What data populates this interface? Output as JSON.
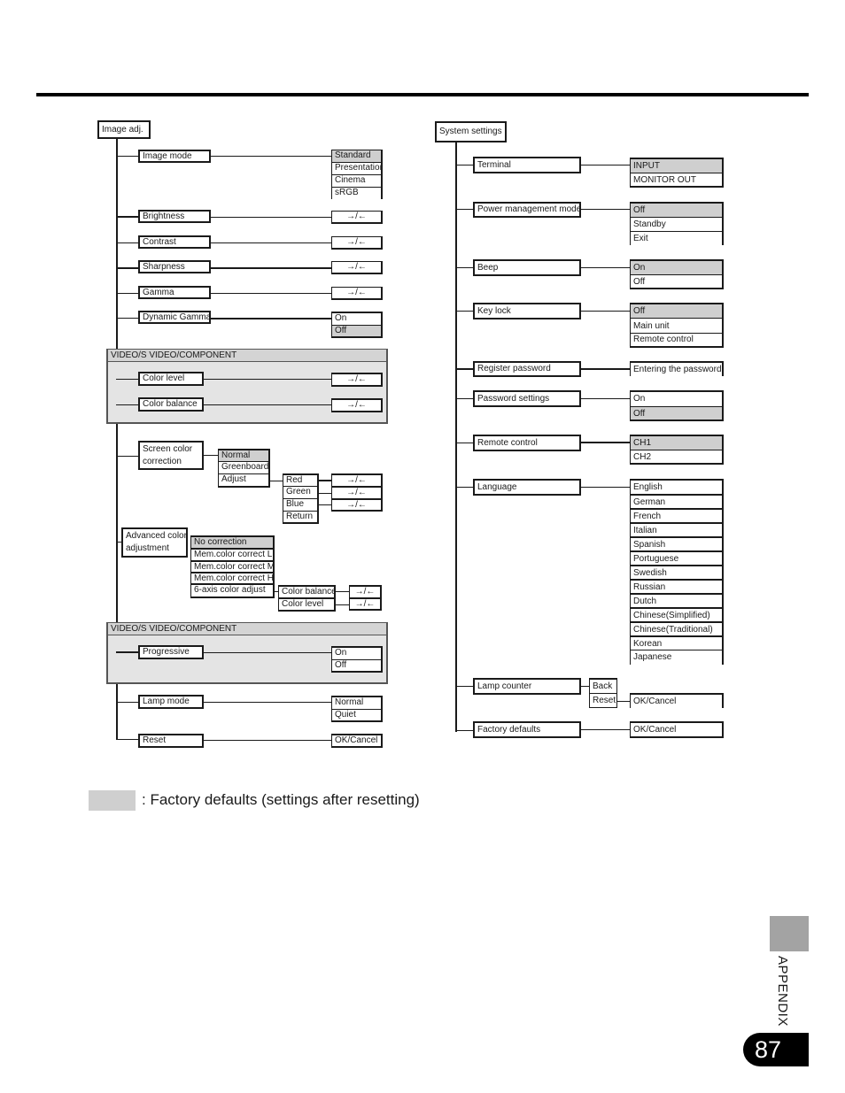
{
  "legend": {
    "text": ": Factory defaults (settings after resetting)",
    "default_color": "#cfcfcf"
  },
  "side_tab": {
    "label": "APPENDIX",
    "page_number": "87"
  },
  "image_adj": {
    "title": "Image adj.",
    "arrow_symbol": "→/←",
    "image_mode": {
      "label": "Image mode",
      "options": [
        "Standard",
        "Presentation",
        "Cinema",
        "sRGB"
      ],
      "default": "Standard"
    },
    "brightness": {
      "label": "Brightness"
    },
    "contrast": {
      "label": "Contrast"
    },
    "sharpness": {
      "label": "Sharpness"
    },
    "gamma": {
      "label": "Gamma"
    },
    "dynamic_gamma": {
      "label": "Dynamic Gamma",
      "options": [
        "On",
        "Off"
      ],
      "default": "Off"
    },
    "group1": {
      "title": "VIDEO/S VIDEO/COMPONENT",
      "color_level": "Color level",
      "color_balance": "Color balance"
    },
    "screen_color": {
      "label_line1": "Screen color",
      "label_line2": "correction",
      "options": [
        "Normal",
        "Greenboard",
        "Adjust"
      ],
      "default": "Normal",
      "adjust_options": [
        "Red",
        "Green",
        "Blue",
        "Return"
      ]
    },
    "advanced_color": {
      "label_line1": "Advanced color",
      "label_line2": "adjustment",
      "options": [
        "No correction",
        "Mem.color correct L",
        "Mem.color correct M",
        "Mem.color correct H",
        "6-axis color adjust"
      ],
      "default": "No correction",
      "six_axis_options": [
        "Color balance",
        "Color level"
      ]
    },
    "group2": {
      "title": "VIDEO/S VIDEO/COMPONENT",
      "progressive": "Progressive",
      "options": [
        "On",
        "Off"
      ]
    },
    "lamp_mode": {
      "label": "Lamp mode",
      "options": [
        "Normal",
        "Quiet"
      ]
    },
    "reset": {
      "label": "Reset",
      "option": "OK/Cancel"
    }
  },
  "system_settings": {
    "title": "System settings",
    "terminal": {
      "label": "Terminal",
      "options": [
        "INPUT",
        "MONITOR OUT"
      ],
      "default": "INPUT"
    },
    "power": {
      "label": "Power management mode",
      "options": [
        "Off",
        "Standby",
        "Exit"
      ],
      "default": "Off"
    },
    "beep": {
      "label": "Beep",
      "options": [
        "On",
        "Off"
      ],
      "default": "On"
    },
    "key_lock": {
      "label": "Key lock",
      "options": [
        "Off",
        "Main unit",
        "Remote control"
      ],
      "default": "Off"
    },
    "register_password": {
      "label": "Register password",
      "option": "Entering the password"
    },
    "password_settings": {
      "label": "Password settings",
      "options": [
        "On",
        "Off"
      ],
      "default": "Off"
    },
    "remote_control": {
      "label": "Remote control",
      "options": [
        "CH1",
        "CH2"
      ],
      "default": "CH1"
    },
    "language": {
      "label": "Language",
      "options": [
        "English",
        "German",
        "French",
        "Italian",
        "Spanish",
        "Portuguese",
        "Swedish",
        "Russian",
        "Dutch",
        "Chinese(Simplified)",
        "Chinese(Traditional)",
        "Korean",
        "Japanese"
      ]
    },
    "lamp_counter": {
      "label": "Lamp counter",
      "options": [
        "Back",
        "Reset"
      ],
      "reset_option": "OK/Cancel"
    },
    "factory_defaults": {
      "label": "Factory defaults",
      "option": "OK/Cancel"
    }
  }
}
